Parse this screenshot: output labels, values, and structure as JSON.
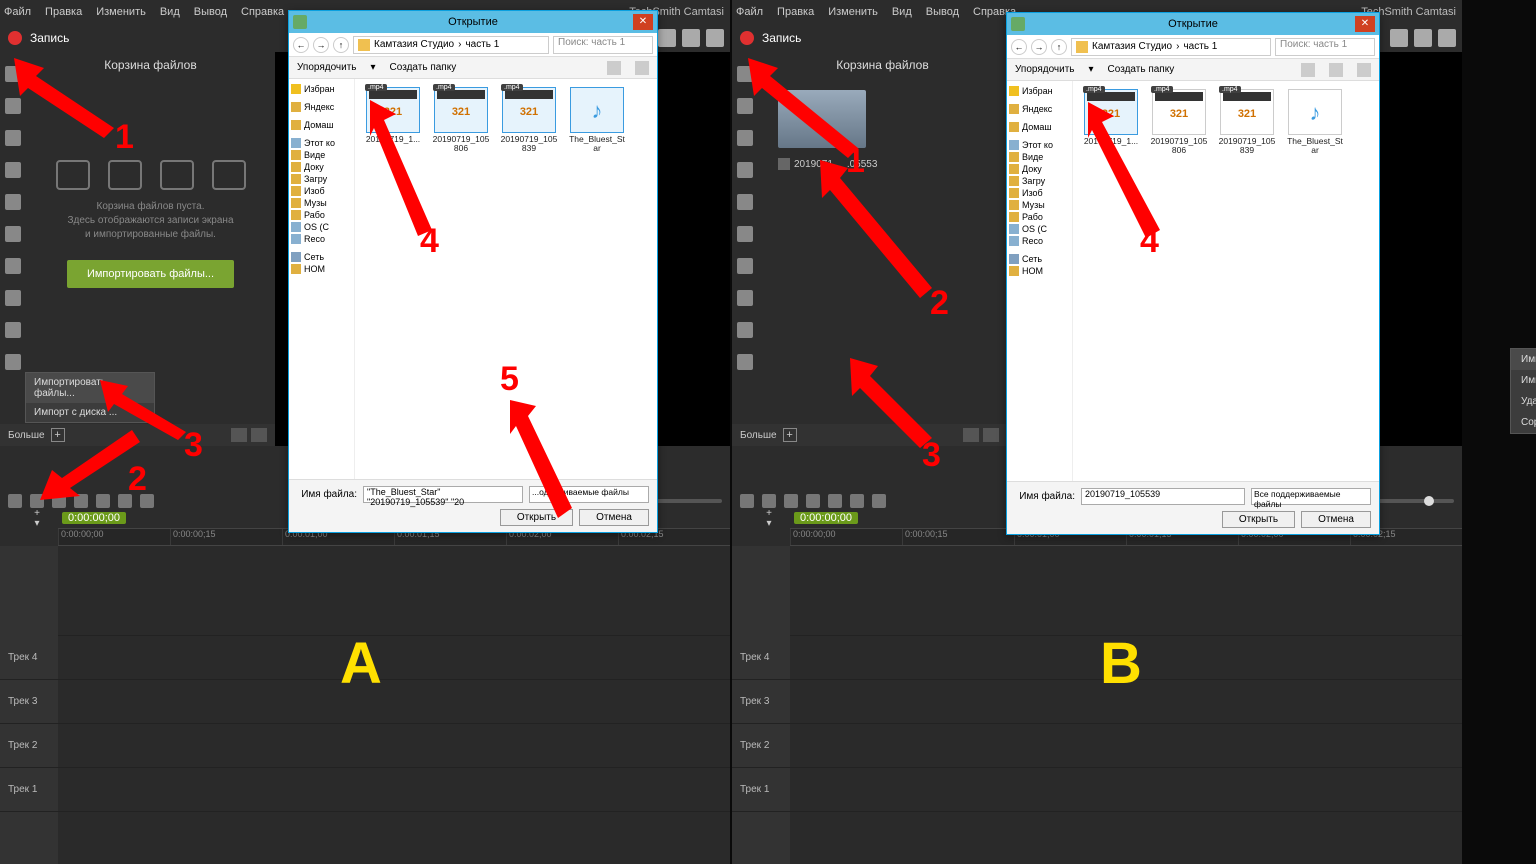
{
  "app": {
    "title": "TechSmith Camtasi",
    "record": "Запись"
  },
  "menu": {
    "m0": "Файл",
    "m1": "Правка",
    "m2": "Изменить",
    "m3": "Вид",
    "m4": "Вывод",
    "m5": "Справка"
  },
  "bin": {
    "title": "Корзина файлов",
    "empty1": "Корзина файлов пуста.",
    "empty2": "Здесь отображаются записи экрана",
    "empty3": "и импортированные файлы.",
    "import_btn": "Импортировать файлы...",
    "more": "Больше",
    "clip_name": "2019071..._.05553"
  },
  "ctxA": {
    "i0": "Импортировать файлы...",
    "i1": "Импорт с диска ..."
  },
  "ctxB": {
    "i0": "Импортировать файлы...",
    "i1": "Импорт с диска ...",
    "i2": "Удалить неиспольз... файлы",
    "i3": "Сортировка"
  },
  "dialog": {
    "title": "Открытие",
    "crumb1": "Камтазия Студио",
    "crumb2": "часть 1",
    "search_ph": "Поиск: часть 1",
    "arrange": "Упорядочить",
    "newfolder": "Создать папку",
    "tree": {
      "t0": "Избран",
      "t1": "Яндекс",
      "t2": "Домаш",
      "t3": "Этот ко",
      "t4": "Виде",
      "t5": "Доку",
      "t6": "Загру",
      "t7": "Изоб",
      "t8": "Музы",
      "t9": "Рабо",
      "t10": "OS (C",
      "t11": "Reco",
      "t12": "Сеть",
      "t13": "HOM"
    },
    "files": {
      "f0": "20190719_1...",
      "f1": "20190719_105806",
      "f2": "20190719_105839",
      "f3": "The_Bluest_Star"
    },
    "badge": ".mp4",
    "fn_label": "Имя файла:",
    "fn_valueA": "\"The_Bluest_Star\" \"20190719_105539\" \"20",
    "fn_valueB": "20190719_105539",
    "filterA": "...одерживаемые файлы",
    "filterB": "Все поддерживаемые файлы",
    "open": "Открыть",
    "cancel": "Отмена"
  },
  "timeline": {
    "cur": "0:00:00;00",
    "r0": "0:00:00;00",
    "r1": "0:00:00;15",
    "r2": "0:00:01;00",
    "r3": "0:00:01;15",
    "r4": "0:00:02;00",
    "r5": "0:00:02;15",
    "t4": "Трек 4",
    "t3": "Трек 3",
    "t2": "Трек 2",
    "t1": "Трек 1"
  },
  "labels": {
    "A": "A",
    "B": "B",
    "n1": "1",
    "n2": "2",
    "n3": "3",
    "n4": "4",
    "n5": "5"
  }
}
